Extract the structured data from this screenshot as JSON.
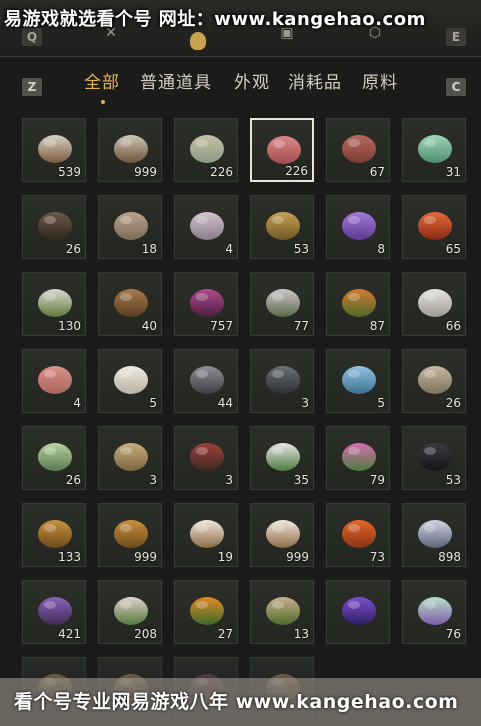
{
  "watermark_top": "易游戏就选看个号   网址：www.kangehao.com",
  "watermark_bottom": "看个号专业网易游戏八年  www.kangehao.com",
  "top_keys": {
    "left": "Q",
    "right": "E"
  },
  "categories": {
    "left_key": "Z",
    "right_key": "C",
    "tabs": [
      "全部",
      "普通道具",
      "外观",
      "消耗品",
      "原料"
    ],
    "active_index": 0
  },
  "colors": {
    "accent": "#e7b356",
    "slot_bg": "#2a2c28",
    "selected_border": "#e8e4d7"
  },
  "items": [
    {
      "icon": "mushrooms-icon",
      "count": "539",
      "c1": "#d9d2c4",
      "c2": "#7a5a3e"
    },
    {
      "icon": "mushrooms-icon",
      "count": "999",
      "c1": "#cfc6b4",
      "c2": "#6e513a"
    },
    {
      "icon": "eggs-icon",
      "count": "226",
      "c1": "#c9bfa5",
      "c2": "#8a9b86"
    },
    {
      "icon": "raw-meat-icon",
      "count": "226",
      "c1": "#d98a8a",
      "c2": "#a44c4c",
      "selected": true
    },
    {
      "icon": "steak-icon",
      "count": "67",
      "c1": "#b86a62",
      "c2": "#7b3b35"
    },
    {
      "icon": "jade-stone-icon",
      "count": "31",
      "c1": "#9fd6b6",
      "c2": "#4f8d6e"
    },
    {
      "icon": "feathers-icon",
      "count": "26",
      "c1": "#6d5a45",
      "c2": "#2f261d"
    },
    {
      "icon": "fur-pelt-icon",
      "count": "18",
      "c1": "#b9a48a",
      "c2": "#7d6b57"
    },
    {
      "icon": "cloth-roll-icon",
      "count": "4",
      "c1": "#cfc3cc",
      "c2": "#8b7b8a"
    },
    {
      "icon": "gold-ore-icon",
      "count": "53",
      "c1": "#c7a154",
      "c2": "#6f5724"
    },
    {
      "icon": "amethyst-icon",
      "count": "8",
      "c1": "#a27ad9",
      "c2": "#5d3a94"
    },
    {
      "icon": "red-gem-icon",
      "count": "65",
      "c1": "#e46a3b",
      "c2": "#8a2a14"
    },
    {
      "icon": "herb-icon",
      "count": "130",
      "c1": "#d8d8d0",
      "c2": "#5f7a3b"
    },
    {
      "icon": "herb-bowl-icon",
      "count": "40",
      "c1": "#a67c4f",
      "c2": "#5a3b20"
    },
    {
      "icon": "purple-flower-icon",
      "count": "757",
      "c1": "#b04a8e",
      "c2": "#4b2040"
    },
    {
      "icon": "white-flower-icon",
      "count": "77",
      "c1": "#cfc6cc",
      "c2": "#5b6a47"
    },
    {
      "icon": "orange-flower-icon",
      "count": "87",
      "c1": "#d47a2e",
      "c2": "#4f6b2b"
    },
    {
      "icon": "white-feather-icon",
      "count": "66",
      "c1": "#e6e4df",
      "c2": "#9d9a93"
    },
    {
      "icon": "meat-slices-icon",
      "count": "4",
      "c1": "#d9918a",
      "c2": "#a8655c"
    },
    {
      "icon": "white-wool-icon",
      "count": "5",
      "c1": "#efeae0",
      "c2": "#b7b1a4"
    },
    {
      "icon": "dark-ore-icon",
      "count": "44",
      "c1": "#8c8f93",
      "c2": "#3d3f42"
    },
    {
      "icon": "black-stone-icon",
      "count": "3",
      "c1": "#6c7075",
      "c2": "#2c2f33"
    },
    {
      "icon": "blue-crystal-icon",
      "count": "5",
      "c1": "#8fc2df",
      "c2": "#3f7292"
    },
    {
      "icon": "bone-icon",
      "count": "26",
      "c1": "#c8bba4",
      "c2": "#7d705b"
    },
    {
      "icon": "melon-icon",
      "count": "26",
      "c1": "#b6d1a3",
      "c2": "#5b7a4d"
    },
    {
      "icon": "grain-sack-icon",
      "count": "3",
      "c1": "#c4ab7c",
      "c2": "#7d6741"
    },
    {
      "icon": "berry-twig-icon",
      "count": "3",
      "c1": "#a0403a",
      "c2": "#3b2a22"
    },
    {
      "icon": "daisy-icon",
      "count": "35",
      "c1": "#e6e6e6",
      "c2": "#4e7b3c"
    },
    {
      "icon": "pink-flower-icon",
      "count": "79",
      "c1": "#d56fb0",
      "c2": "#4e7b3c"
    },
    {
      "icon": "dark-feather-icon",
      "count": "53",
      "c1": "#3a3b3f",
      "c2": "#15161a"
    },
    {
      "icon": "bread-icon",
      "count": "133",
      "c1": "#c9913f",
      "c2": "#6d4a1a"
    },
    {
      "icon": "bread-icon",
      "count": "999",
      "c1": "#c9913f",
      "c2": "#6d4a1a"
    },
    {
      "icon": "rice-bowl-icon",
      "count": "19",
      "c1": "#efe9dc",
      "c2": "#8c6a44"
    },
    {
      "icon": "rice-bowl-icon",
      "count": "999",
      "c1": "#efe9dc",
      "c2": "#8c6a44"
    },
    {
      "icon": "orange-slab-icon",
      "count": "73",
      "c1": "#e2692b",
      "c2": "#8a3412"
    },
    {
      "icon": "spark-flower-icon",
      "count": "898",
      "c1": "#cfd5e6",
      "c2": "#5c6377"
    },
    {
      "icon": "lavender-icon",
      "count": "421",
      "c1": "#8a63b8",
      "c2": "#3f2c58"
    },
    {
      "icon": "pale-flower-icon",
      "count": "208",
      "c1": "#e0d2cf",
      "c2": "#557a3c"
    },
    {
      "icon": "orange-berry-icon",
      "count": "27",
      "c1": "#e08a2a",
      "c2": "#3f6a2a"
    },
    {
      "icon": "root-icon",
      "count": "13",
      "c1": "#c8b08a",
      "c2": "#4f6b2b"
    },
    {
      "icon": "purple-ore-icon",
      "count": "",
      "c1": "#7d4fd0",
      "c2": "#2c1f63"
    },
    {
      "icon": "gift-box-icon",
      "count": "76",
      "c1": "#b7e0c9",
      "c2": "#7d5ca8"
    },
    {
      "icon": "partial-item-icon",
      "count": "",
      "c1": "#8c7a5e",
      "c2": "#3d3326"
    },
    {
      "icon": "partial-item-icon",
      "count": "",
      "c1": "#8c7a5e",
      "c2": "#3d3326"
    },
    {
      "icon": "partial-item-icon",
      "count": "",
      "c1": "#6b4d55",
      "c2": "#2f2226"
    },
    {
      "icon": "partial-item-icon",
      "count": "",
      "c1": "#8c7a5e",
      "c2": "#3d3326"
    }
  ]
}
